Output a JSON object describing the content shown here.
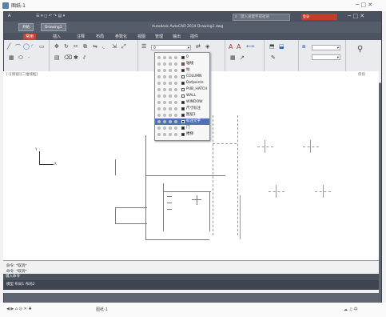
{
  "window": {
    "title": "图纸-1",
    "controls": "─ □ ✕"
  },
  "app": {
    "title": "A",
    "quick_access": "☰ ▾ ◻ ↶ ↷ ▤ ▾",
    "search_placeholder": "键入关键字或短语",
    "account": "登录",
    "controls": "─ □ ✕"
  },
  "doc_tabs": [
    "开始",
    "Drawing1"
  ],
  "doc_name": "Autodesk AutoCAD 2014  Drawing1.dwg",
  "ribbon_tabs": [
    {
      "label": "常用",
      "active": true
    },
    {
      "label": "插入"
    },
    {
      "label": "注释"
    },
    {
      "label": "布局"
    },
    {
      "label": "参数化"
    },
    {
      "label": "视图"
    },
    {
      "label": "管理"
    },
    {
      "label": "输出"
    },
    {
      "label": "插件"
    }
  ],
  "ribbon_groups": [
    "绘图",
    "修改",
    "图层",
    "注释",
    "块",
    "特性",
    "实用工具"
  ],
  "layer_combo": "0",
  "view_label": "[-][俯视][二维线框]",
  "view_right": "俯视",
  "layers": [
    {
      "name": "0",
      "color": "#222222"
    },
    {
      "name": "轴线",
      "color": "#d03030"
    },
    {
      "name": "柱",
      "color": "#222222"
    },
    {
      "name": "COLUMN",
      "color": "#ffffff"
    },
    {
      "name": "Defpoints",
      "color": "#222222"
    },
    {
      "name": "PUB_HATCH",
      "color": "#ffffff"
    },
    {
      "name": "WALL",
      "color": "#ffffff"
    },
    {
      "name": "WINDOW",
      "color": "#222222"
    },
    {
      "name": "尺寸标注",
      "color": "#222222"
    },
    {
      "name": "图层1",
      "color": "#222222"
    },
    {
      "name": "标注文字",
      "color": "#222222",
      "selected": true
    },
    {
      "name": "门",
      "color": "#222222"
    },
    {
      "name": "楼梯",
      "color": "#222222"
    },
    {
      "name": "文字说明",
      "color": "#222222"
    }
  ],
  "command": {
    "history": [
      "命令: *取消*",
      "命令: *取消*",
      "命令:"
    ],
    "prompt": "键入命令",
    "status": "模型  布局1  布局2"
  },
  "taskbar": {
    "left": "◀ ▶ ⌂ ◎ ✕ ♣",
    "middle": "图纸-1",
    "right": "☁ ♫ 中"
  }
}
